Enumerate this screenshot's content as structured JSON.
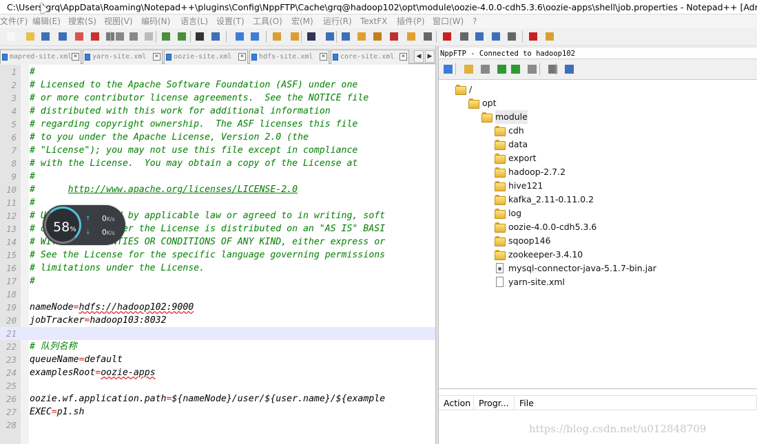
{
  "window": {
    "title": "C:\\Users\\grq\\AppData\\Roaming\\Notepad++\\plugins\\Config\\NppFTP\\Cache\\grq@hadoop102\\opt\\module\\oozie-4.0.0-cdh5.3.6\\oozie-apps\\shell\\job.properties - Notepad++ [Administrator]"
  },
  "menu": [
    "文件(F)",
    "编辑(E)",
    "搜索(S)",
    "视图(V)",
    "编码(N)",
    "语言(L)",
    "设置(T)",
    "工具(O)",
    "宏(M)",
    "运行(R)",
    "TextFX",
    "插件(P)",
    "窗口(W)",
    "?"
  ],
  "toolbar": {
    "icons": [
      "new-file-icon",
      "open-file-icon",
      "save-icon",
      "save-all-icon",
      "close-icon",
      "close-all-icon",
      "print-icon",
      "cut-icon",
      "copy-icon",
      "paste-icon",
      "undo-icon",
      "redo-icon",
      "find-icon",
      "replace-icon",
      "zoom-in-icon",
      "zoom-out-icon",
      "sync-vertical-icon",
      "sync-horizontal-icon",
      "word-wrap-icon",
      "show-all-chars-icon",
      "indent-guide-icon",
      "user-lang-icon",
      "doc-map-icon",
      "function-list-icon",
      "folder-workspace-icon",
      "monitor-icon",
      "record-macro-icon",
      "stop-record-icon",
      "play-macro-icon",
      "run-macro-multiple-icon",
      "save-macro-icon",
      "spellcheck-icon",
      "nppftp-icon"
    ]
  },
  "tabs": [
    {
      "label": "mapred-site.xml"
    },
    {
      "label": "yarn-site.xml"
    },
    {
      "label": "oozie-site.xml"
    },
    {
      "label": "hdfs-site.xml"
    },
    {
      "label": "core-site.xml"
    }
  ],
  "editor": {
    "current_line": 21,
    "lines": [
      {
        "n": "1",
        "kind": "comment",
        "text": "#"
      },
      {
        "n": "2",
        "kind": "comment",
        "text": "# Licensed to the Apache Software Foundation (ASF) under one"
      },
      {
        "n": "3",
        "kind": "comment",
        "text": "# or more contributor license agreements.  See the NOTICE file"
      },
      {
        "n": "4",
        "kind": "comment",
        "text": "# distributed with this work for additional information"
      },
      {
        "n": "5",
        "kind": "comment",
        "text": "# regarding copyright ownership.  The ASF licenses this file"
      },
      {
        "n": "6",
        "kind": "comment",
        "text": "# to you under the Apache License, Version 2.0 (the"
      },
      {
        "n": "7",
        "kind": "comment",
        "text": "# \"License\"); you may not use this file except in compliance"
      },
      {
        "n": "8",
        "kind": "comment",
        "text": "# with the License.  You may obtain a copy of the License at"
      },
      {
        "n": "9",
        "kind": "comment",
        "text": "#"
      },
      {
        "n": "10",
        "kind": "comment-url",
        "text": "#      ",
        "url": "http://www.apache.org/licenses/LICENSE-2.0"
      },
      {
        "n": "11",
        "kind": "comment",
        "text": "#"
      },
      {
        "n": "12",
        "kind": "comment",
        "text": "# Unless required by applicable law or agreed to in writing, soft"
      },
      {
        "n": "13",
        "kind": "comment",
        "text": "# distributed under the License is distributed on an \"AS IS\" BASI"
      },
      {
        "n": "14",
        "kind": "comment",
        "text": "# WITHOUT WARRANTIES OR CONDITIONS OF ANY KIND, either express or"
      },
      {
        "n": "15",
        "kind": "comment",
        "text": "# See the License for the specific language governing permissions"
      },
      {
        "n": "16",
        "kind": "comment",
        "text": "# limitations under the License."
      },
      {
        "n": "17",
        "kind": "comment",
        "text": "#"
      },
      {
        "n": "18",
        "kind": "blank",
        "text": ""
      },
      {
        "n": "19",
        "kind": "prop",
        "key": "nameNode",
        "value": "hdfs://hadoop102:9000",
        "squiggle": true
      },
      {
        "n": "20",
        "kind": "prop",
        "key": "jobTracker",
        "value": "hadoop103:8032",
        "squiggle": false
      },
      {
        "n": "21",
        "kind": "blank",
        "text": ""
      },
      {
        "n": "22",
        "kind": "comment",
        "text": "# 队列名称"
      },
      {
        "n": "23",
        "kind": "prop",
        "key": "queueName",
        "value": "default",
        "squiggle": false
      },
      {
        "n": "24",
        "kind": "prop",
        "key": "examplesRoot",
        "value": "oozie-apps",
        "squiggle": true
      },
      {
        "n": "25",
        "kind": "blank",
        "text": ""
      },
      {
        "n": "26",
        "kind": "prop",
        "key": "oozie.wf.application.path",
        "value": "${nameNode}/user/${user.name}/${example",
        "squiggle": false
      },
      {
        "n": "27",
        "kind": "prop",
        "key": "EXEC",
        "value": "p1.sh",
        "squiggle": false
      },
      {
        "n": "28",
        "kind": "blank",
        "text": ""
      }
    ]
  },
  "ftp": {
    "status": "NppFTP - Connected to hadoop102",
    "toolbar_icons": [
      "connect-icon",
      "open-folder-icon",
      "download-icon",
      "upload-icon",
      "refresh-icon",
      "abort-icon",
      "settings-icon",
      "message-window-icon"
    ],
    "tree": [
      {
        "label": "/",
        "type": "folder",
        "depth": 0,
        "selected": false
      },
      {
        "label": "opt",
        "type": "folder",
        "depth": 1,
        "selected": false
      },
      {
        "label": "module",
        "type": "folder",
        "depth": 2,
        "selected": true
      },
      {
        "label": "cdh",
        "type": "folder",
        "depth": 3,
        "selected": false
      },
      {
        "label": "data",
        "type": "folder",
        "depth": 3,
        "selected": false
      },
      {
        "label": "export",
        "type": "folder",
        "depth": 3,
        "selected": false
      },
      {
        "label": "hadoop-2.7.2",
        "type": "folder",
        "depth": 3,
        "selected": false
      },
      {
        "label": "hive121",
        "type": "folder",
        "depth": 3,
        "selected": false
      },
      {
        "label": "kafka_2.11-0.11.0.2",
        "type": "folder",
        "depth": 3,
        "selected": false
      },
      {
        "label": "log",
        "type": "folder",
        "depth": 3,
        "selected": false
      },
      {
        "label": "oozie-4.0.0-cdh5.3.6",
        "type": "folder",
        "depth": 3,
        "selected": false
      },
      {
        "label": "sqoop146",
        "type": "folder",
        "depth": 3,
        "selected": false
      },
      {
        "label": "zookeeper-3.4.10",
        "type": "folder",
        "depth": 3,
        "selected": false
      },
      {
        "label": "mysql-connector-java-5.1.7-bin.jar",
        "type": "jar",
        "depth": 3,
        "selected": false
      },
      {
        "label": "yarn-site.xml",
        "type": "file",
        "depth": 3,
        "selected": false
      }
    ],
    "queue_columns": [
      "Action",
      "Progr...",
      "File"
    ]
  },
  "netmon": {
    "percent": "58",
    "percent_symbol": "%",
    "upload": "0",
    "download": "0",
    "unit": "K/s"
  },
  "watermark": "https://blog.csdn.net/u012848709",
  "colors": {
    "comment": "#008000",
    "operator": "#d02020",
    "current_line": "#e8e8ff",
    "gauge_accent": "#4fc3d8"
  }
}
